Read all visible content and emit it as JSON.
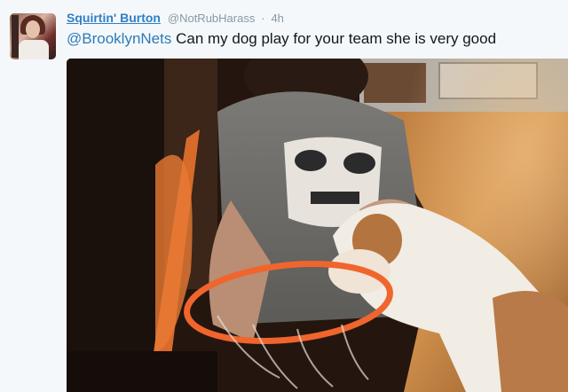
{
  "tweet": {
    "display_name": "Squirtin' Burton",
    "handle": "@NotRubHarass",
    "separator": "·",
    "timestamp": "4h",
    "mention": "@BrooklynNets",
    "body": " Can my dog play for your team she is very good"
  },
  "colors": {
    "name": "#2f7fc5",
    "mention": "#2b7bb9",
    "meta": "#8899a6",
    "background": "#f5f8fa"
  }
}
